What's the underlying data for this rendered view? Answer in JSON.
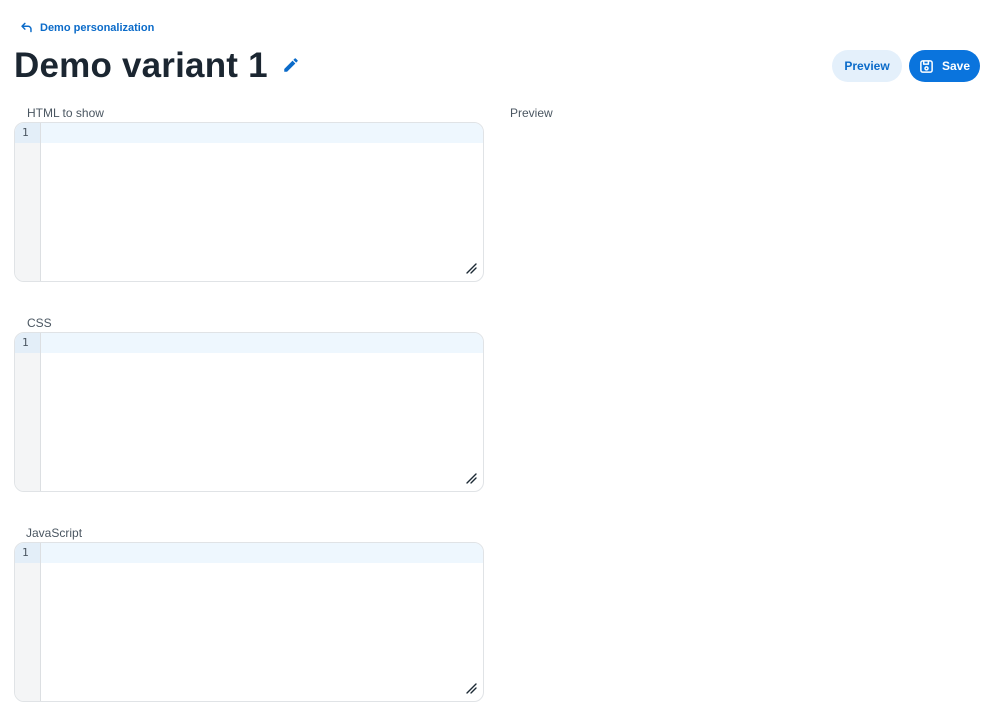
{
  "header": {
    "back_label": "Demo personalization",
    "title": "Demo variant 1"
  },
  "actions": {
    "preview_label": "Preview",
    "save_label": "Save"
  },
  "editors": [
    {
      "label": "HTML to show",
      "line_number": "1",
      "value": ""
    },
    {
      "label": "CSS",
      "line_number": "1",
      "value": ""
    },
    {
      "label": "JavaScript",
      "line_number": "1",
      "value": ""
    }
  ],
  "preview_panel": {
    "label": "Preview"
  },
  "colors": {
    "accent": "#0a74dd",
    "link": "#0b6bc9",
    "secondary_button_bg": "#e4f0fb"
  },
  "icons": {
    "back": "back-arrow-icon",
    "edit": "pencil-icon",
    "save": "floppy-disk-icon",
    "resize": "resize-handle-icon"
  }
}
